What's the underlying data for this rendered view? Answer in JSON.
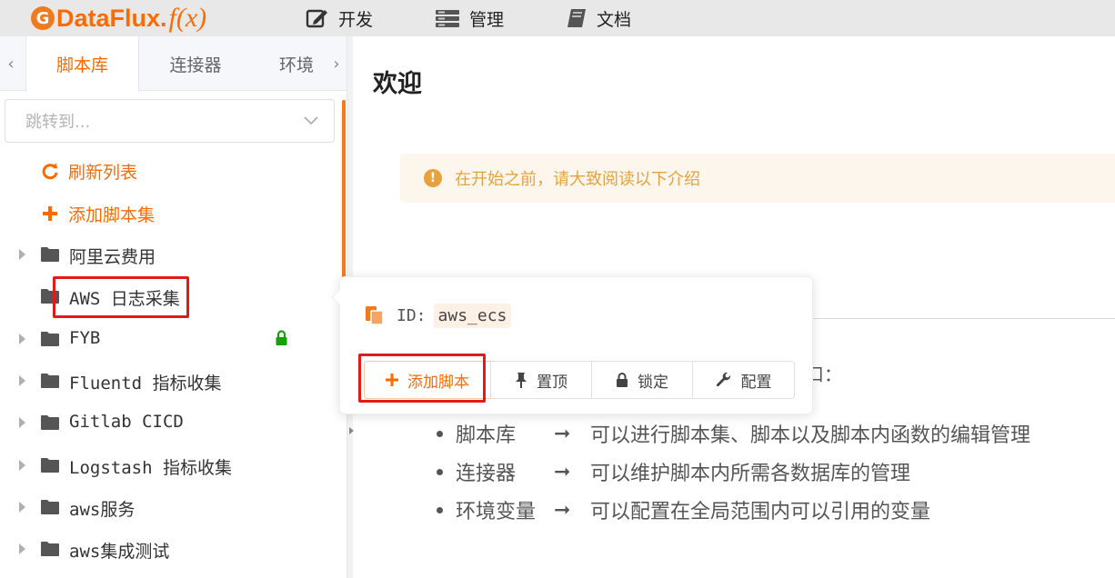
{
  "header": {
    "logo_text": "DataFlux.",
    "logo_fx": "f(x)",
    "nav": [
      {
        "label": "开发",
        "icon": "edit-icon"
      },
      {
        "label": "管理",
        "icon": "server-icon"
      },
      {
        "label": "文档",
        "icon": "book-icon"
      }
    ]
  },
  "sidebar": {
    "tabs": [
      "脚本库",
      "连接器",
      "环境"
    ],
    "active_tab": "脚本库",
    "jump_placeholder": "跳转到...",
    "actions": [
      {
        "label": "刷新列表",
        "icon": "refresh-icon"
      },
      {
        "label": "添加脚本集",
        "icon": "plus-icon"
      }
    ],
    "script_sets": [
      {
        "label": "阿里云费用",
        "expandable": true,
        "locked": false
      },
      {
        "label": "AWS 日志采集",
        "expandable": false,
        "locked": false,
        "highlighted": true
      },
      {
        "label": "FYB",
        "expandable": true,
        "locked": true
      },
      {
        "label": "Fluentd 指标收集",
        "expandable": true,
        "locked": false
      },
      {
        "label": "Gitlab CICD",
        "expandable": true,
        "locked": false
      },
      {
        "label": "Logstash 指标收集",
        "expandable": true,
        "locked": false
      },
      {
        "label": "aws服务",
        "expandable": true,
        "locked": false
      },
      {
        "label": "aws集成测试",
        "expandable": true,
        "locked": false
      }
    ],
    "colors": {
      "accent": "#ff6a00",
      "lock": "#13a10e",
      "highlight": "#e31a1a"
    }
  },
  "main": {
    "title": "欢迎",
    "notice": "在开始之前，请大致阅读以下介绍",
    "entry_tail": "口：",
    "bullets": [
      {
        "name": "脚本库",
        "desc": "可以进行脚本集、脚本以及脚本内函数的编辑管理"
      },
      {
        "name": "连接器",
        "desc": "可以维护脚本内所需各数据库的管理"
      },
      {
        "name": "环境变量",
        "desc": "可以配置在全局范围内可以引用的变量"
      }
    ],
    "arrow": "➞"
  },
  "popover": {
    "id_label": "ID:",
    "id_value": "aws_ecs",
    "buttons": [
      {
        "label": "添加脚本",
        "icon": "plus-icon"
      },
      {
        "label": "置顶",
        "icon": "pin-icon"
      },
      {
        "label": "锁定",
        "icon": "lock-icon"
      },
      {
        "label": "配置",
        "icon": "wrench-icon"
      }
    ]
  }
}
